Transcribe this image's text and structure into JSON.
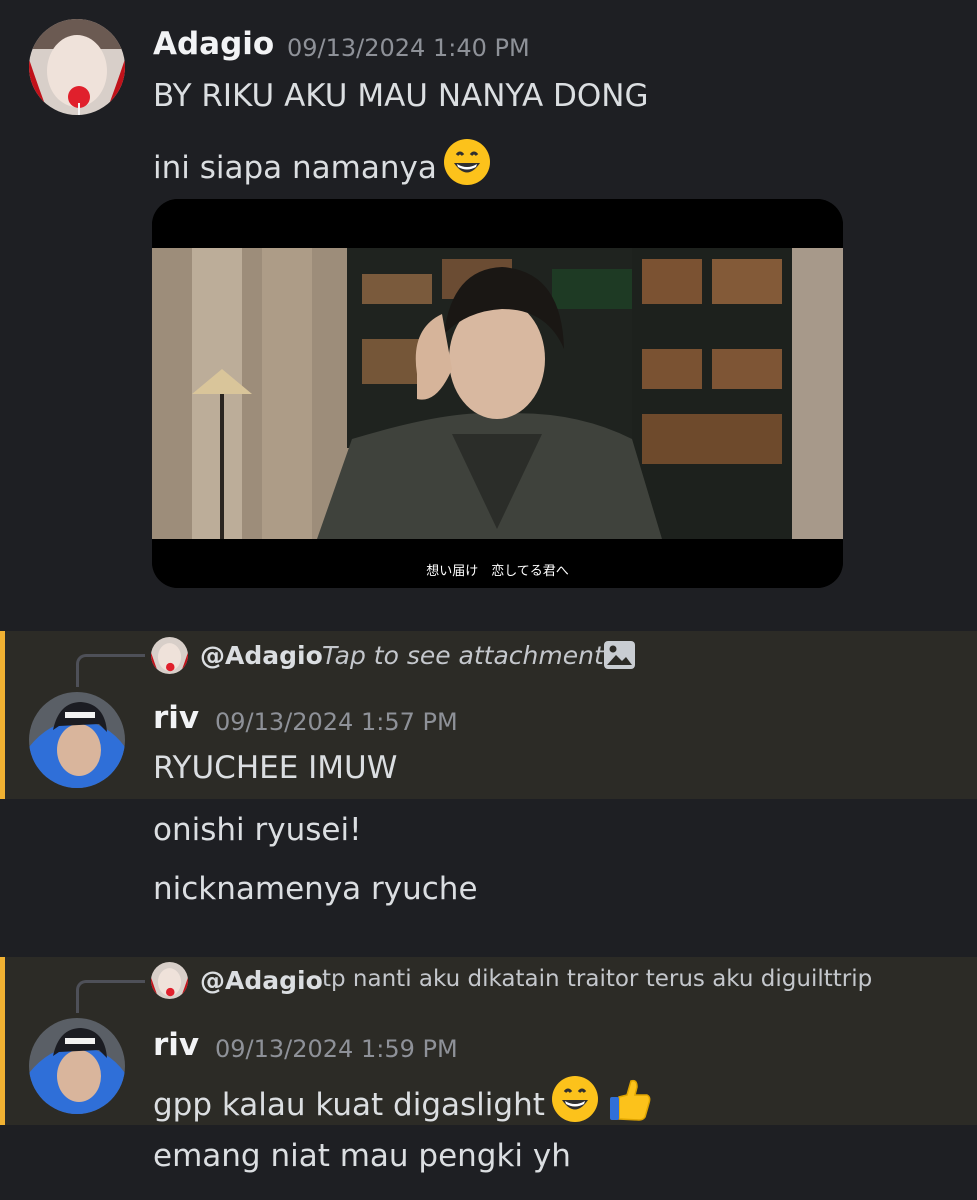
{
  "messages": [
    {
      "username": "Adagio",
      "timestamp": "09/13/2024 1:40 PM",
      "lines": [
        "BY RIKU AKU MAU NANYA DONG",
        "ini siapa namanya"
      ],
      "attachment": {
        "subtitle": "想い届け　恋してる君へ"
      }
    },
    {
      "reply": {
        "mention": "@Adagio",
        "text": "Tap to see attachment",
        "icon": "image-icon"
      },
      "username": "riv",
      "timestamp": "09/13/2024 1:57 PM",
      "lines": [
        "RYUCHEE IMUW",
        "onishi ryusei!",
        "nicknamenya ryuche"
      ]
    },
    {
      "reply": {
        "mention": "@Adagio",
        "text": "tp nanti aku dikatain traitor terus aku diguilttrip"
      },
      "username": "riv",
      "timestamp": "09/13/2024 1:59 PM",
      "lines": [
        "gpp kalau kuat digaslight",
        "emang niat mau pengki yh"
      ]
    }
  ],
  "colors": {
    "background": "#1e1f23",
    "highlight": "#2c2b26",
    "highlight_bar": "#f0b132",
    "username": "#f2f3f5",
    "timestamp": "#8e9198"
  },
  "emojis": [
    "grinning-face-emoji",
    "grinning-face-emoji",
    "thumbs-up-emoji"
  ]
}
